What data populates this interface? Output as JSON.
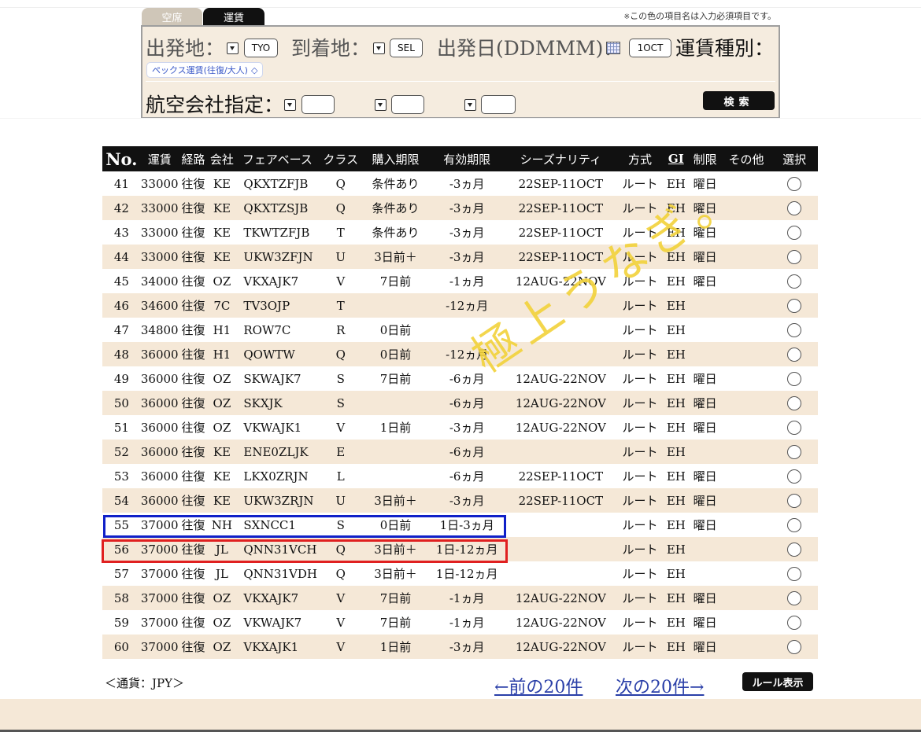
{
  "tabs": [
    "空席",
    "運賃"
  ],
  "note": {
    "mark": "※",
    "text": "この色の項目名は入力必須項目です。"
  },
  "search": {
    "departure_label": "出発地：",
    "departure_value": "TYO",
    "arrival_label": "到着地：",
    "arrival_value": "SEL",
    "date_label": "出発日(DDMMM)：",
    "date_value": "1OCT",
    "fare_type_label": "運賃種別：",
    "fare_type_value": "ペックス運賃(往復/大人)",
    "airline_label": "航空会社指定：",
    "search_button": "検索"
  },
  "table": {
    "headers": [
      "No.",
      "運賃",
      "経路",
      "会社",
      "フェアベース",
      "クラス",
      "購入期限",
      "有効期限",
      "シーズナリティ",
      "方式",
      "GI",
      "制限",
      "その他",
      "選択"
    ],
    "rows": [
      [
        "41",
        "33000",
        "往復",
        "KE",
        "QKXTZFJB",
        "Q",
        "条件あり",
        "-3ヵ月",
        "22SEP-11OCT",
        "ルート",
        "EH",
        "曜日",
        ""
      ],
      [
        "42",
        "33000",
        "往復",
        "KE",
        "QKXTZSJB",
        "Q",
        "条件あり",
        "-3ヵ月",
        "22SEP-11OCT",
        "ルート",
        "EH",
        "曜日",
        ""
      ],
      [
        "43",
        "33000",
        "往復",
        "KE",
        "TKWTZFJB",
        "T",
        "条件あり",
        "-3ヵ月",
        "22SEP-11OCT",
        "ルート",
        "EH",
        "曜日",
        ""
      ],
      [
        "44",
        "33000",
        "往復",
        "KE",
        "UKW3ZFJN",
        "U",
        "3日前＋",
        "-3ヵ月",
        "22SEP-11OCT",
        "ルート",
        "EH",
        "曜日",
        ""
      ],
      [
        "45",
        "34000",
        "往復",
        "OZ",
        "VKXAJK7",
        "V",
        "7日前",
        "-1ヵ月",
        "12AUG-22NOV",
        "ルート",
        "EH",
        "曜日",
        ""
      ],
      [
        "46",
        "34600",
        "往復",
        "7C",
        "TV3OJP",
        "T",
        "",
        "-12ヵ月",
        "",
        "ルート",
        "EH",
        "",
        ""
      ],
      [
        "47",
        "34800",
        "往復",
        "H1",
        "ROW7C",
        "R",
        "0日前",
        "",
        "",
        "ルート",
        "EH",
        "",
        ""
      ],
      [
        "48",
        "36000",
        "往復",
        "H1",
        "QOWTW",
        "Q",
        "0日前",
        "-12ヵ月",
        "",
        "ルート",
        "EH",
        "",
        ""
      ],
      [
        "49",
        "36000",
        "往復",
        "OZ",
        "SKWAJK7",
        "S",
        "7日前",
        "-6ヵ月",
        "12AUG-22NOV",
        "ルート",
        "EH",
        "曜日",
        ""
      ],
      [
        "50",
        "36000",
        "往復",
        "OZ",
        "SKXJK",
        "S",
        "",
        "-6ヵ月",
        "12AUG-22NOV",
        "ルート",
        "EH",
        "曜日",
        ""
      ],
      [
        "51",
        "36000",
        "往復",
        "OZ",
        "VKWAJK1",
        "V",
        "1日前",
        "-3ヵ月",
        "12AUG-22NOV",
        "ルート",
        "EH",
        "曜日",
        ""
      ],
      [
        "52",
        "36000",
        "往復",
        "KE",
        "ENE0ZLJK",
        "E",
        "",
        "-6ヵ月",
        "",
        "ルート",
        "EH",
        "",
        ""
      ],
      [
        "53",
        "36000",
        "往復",
        "KE",
        "LKX0ZRJN",
        "L",
        "",
        "-6ヵ月",
        "22SEP-11OCT",
        "ルート",
        "EH",
        "曜日",
        ""
      ],
      [
        "54",
        "36000",
        "往復",
        "KE",
        "UKW3ZRJN",
        "U",
        "3日前＋",
        "-3ヵ月",
        "22SEP-11OCT",
        "ルート",
        "EH",
        "曜日",
        ""
      ],
      [
        "55",
        "37000",
        "往復",
        "NH",
        "SXNCC1",
        "S",
        "0日前",
        "1日-3ヵ月",
        "",
        "ルート",
        "EH",
        "曜日",
        ""
      ],
      [
        "56",
        "37000",
        "往復",
        "JL",
        "QNN31VCH",
        "Q",
        "3日前＋",
        "1日-12ヵ月",
        "",
        "ルート",
        "EH",
        "",
        ""
      ],
      [
        "57",
        "37000",
        "往復",
        "JL",
        "QNN31VDH",
        "Q",
        "3日前＋",
        "1日-12ヵ月",
        "",
        "ルート",
        "EH",
        "",
        ""
      ],
      [
        "58",
        "37000",
        "往復",
        "OZ",
        "VKXAJK7",
        "V",
        "7日前",
        "-1ヵ月",
        "12AUG-22NOV",
        "ルート",
        "EH",
        "曜日",
        ""
      ],
      [
        "59",
        "37000",
        "往復",
        "OZ",
        "VKWAJK7",
        "V",
        "7日前",
        "-1ヵ月",
        "12AUG-22NOV",
        "ルート",
        "EH",
        "曜日",
        ""
      ],
      [
        "60",
        "37000",
        "往復",
        "OZ",
        "VKXAJK1",
        "V",
        "1日前",
        "-3ヵ月",
        "12AUG-22NOV",
        "ルート",
        "EH",
        "曜日",
        ""
      ]
    ]
  },
  "watermark": "極上うなぎ。",
  "footer": {
    "currency": "＜通貨：JPY＞",
    "prev": "←前の20件",
    "next": "次の20件→",
    "rule_button": "ルール表示"
  },
  "colors": {
    "highlight_blue": "#1020c8",
    "highlight_red": "#e02020",
    "row_alt": "#f5e8d7",
    "panel": "#f5ecdf"
  }
}
